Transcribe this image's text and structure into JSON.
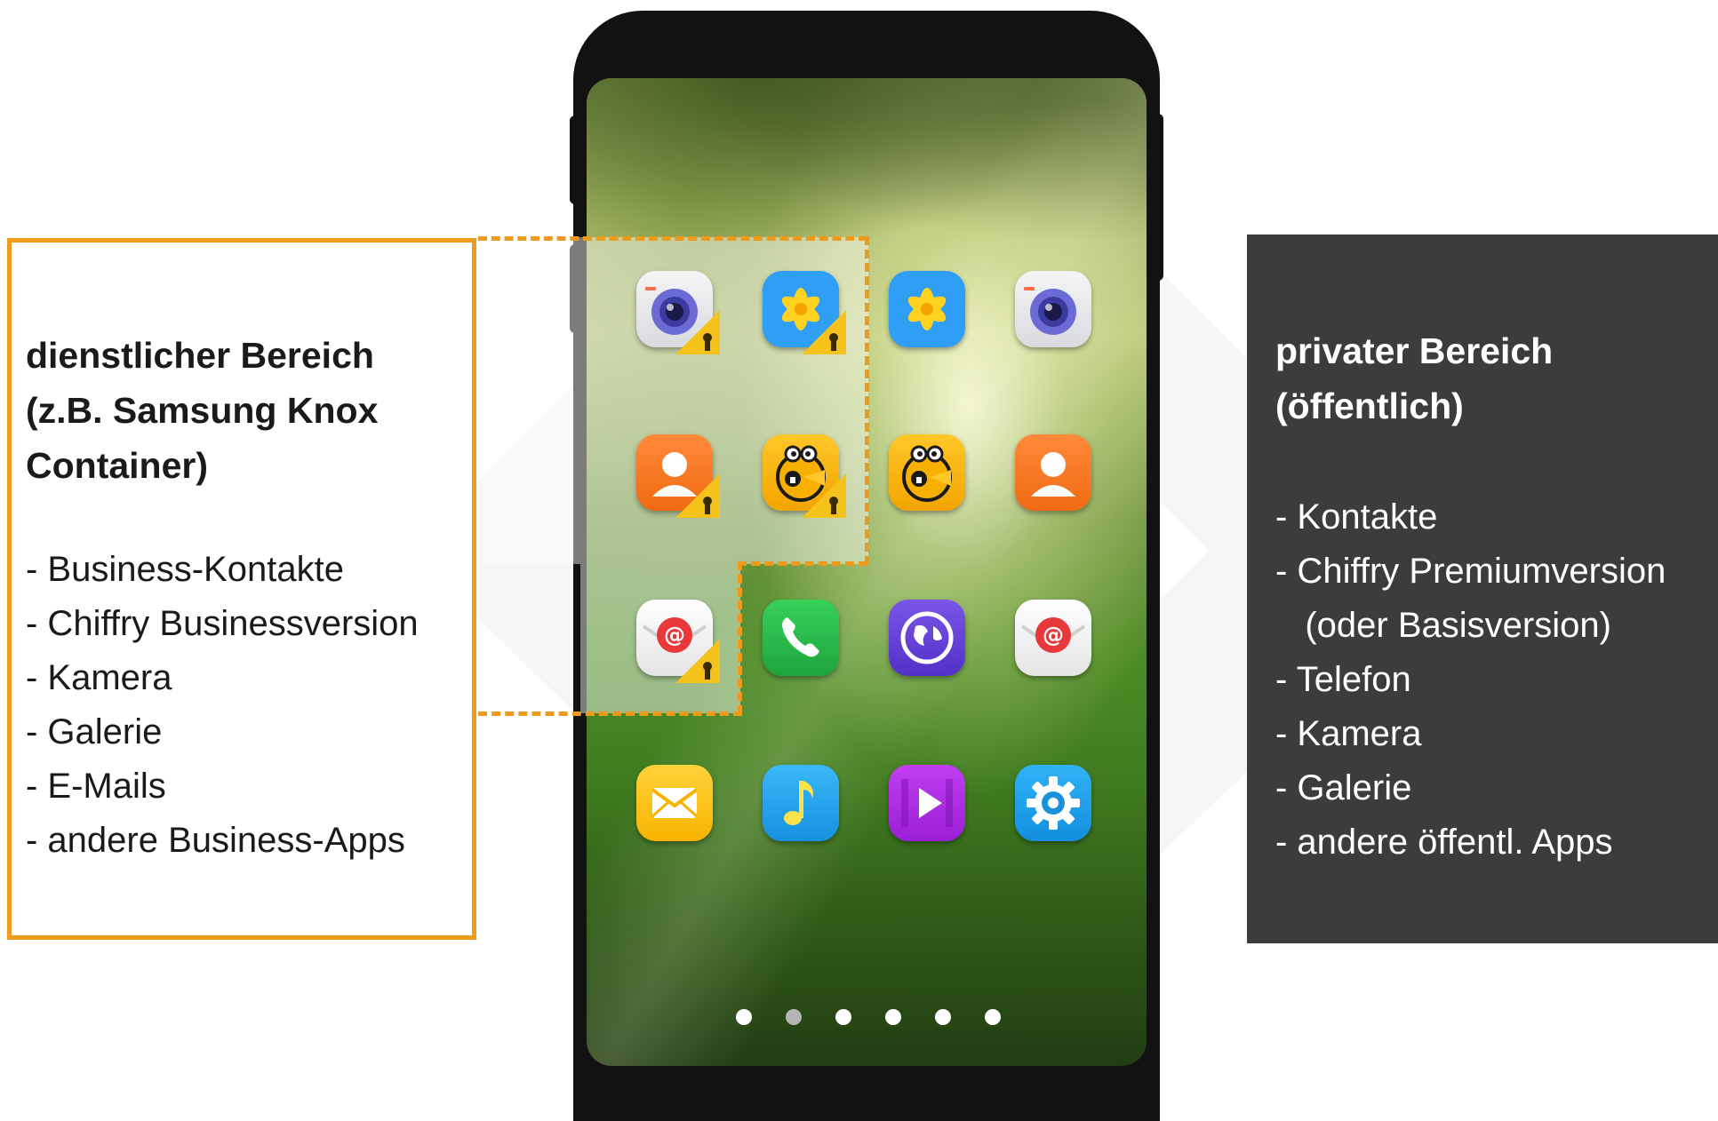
{
  "business": {
    "title": "dienstlicher Bereich\n(z.B. Samsung Knox\nContainer)",
    "items": [
      "- Business-Kontakte",
      "- Chiffry Businessversion",
      "- Kamera",
      "- Galerie",
      "- E-Mails",
      "- andere Business-Apps"
    ]
  },
  "private": {
    "title": "privater Bereich\n(öffentlich)",
    "items": [
      "- Kontakte",
      "- Chiffry Premiumversion",
      "   (oder Basisversion)",
      "- Telefon",
      "- Kamera",
      "- Galerie",
      "- andere öffentl. Apps"
    ]
  },
  "phone": {
    "apps": [
      {
        "name": "camera-app-business",
        "icon": "camera-icon",
        "secured": true
      },
      {
        "name": "gallery-app-business",
        "icon": "gallery-icon",
        "secured": true
      },
      {
        "name": "gallery-app",
        "icon": "gallery-icon",
        "secured": false
      },
      {
        "name": "camera-app",
        "icon": "camera-icon",
        "secured": false
      },
      {
        "name": "contacts-app-business",
        "icon": "contacts-icon",
        "secured": true
      },
      {
        "name": "chiffry-app-business",
        "icon": "chiffry-icon",
        "secured": true
      },
      {
        "name": "chiffry-app",
        "icon": "chiffry-icon",
        "secured": false
      },
      {
        "name": "contacts-app",
        "icon": "contacts-icon",
        "secured": false
      },
      {
        "name": "email-app-business",
        "icon": "email-icon",
        "secured": true
      },
      {
        "name": "phone-app",
        "icon": "phone-icon",
        "secured": false
      },
      {
        "name": "internet-app",
        "icon": "globe-icon",
        "secured": false
      },
      {
        "name": "email-app",
        "icon": "email-icon",
        "secured": false
      },
      {
        "name": "messages-app",
        "icon": "envelope-icon",
        "secured": false
      },
      {
        "name": "music-app",
        "icon": "music-icon",
        "secured": false
      },
      {
        "name": "video-app",
        "icon": "play-icon",
        "secured": false
      },
      {
        "name": "settings-app",
        "icon": "gear-icon",
        "secured": false
      }
    ],
    "page_count": 6,
    "active_page": 2
  },
  "colors": {
    "accent_orange": "#ef9a1b",
    "private_panel": "#3c3c3c",
    "lock_badge": "#f4c21b"
  }
}
